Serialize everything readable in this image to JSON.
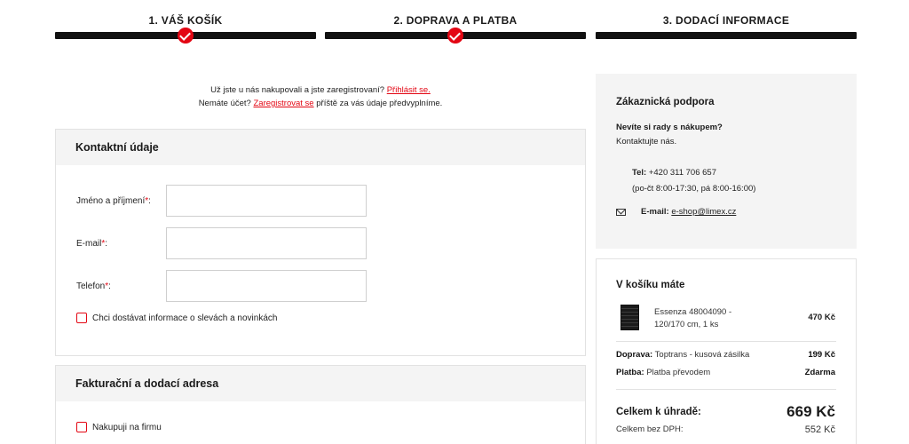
{
  "steps": [
    {
      "label": "1. VÁŠ KOŠÍK",
      "completed": true
    },
    {
      "label": "2. DOPRAVA A PLATBA",
      "completed": true
    },
    {
      "label": "3. DODACÍ INFORMACE",
      "completed": false
    }
  ],
  "login_info": {
    "line1_text": "Už jste u nás nakupovali a jste zaregistrovaní?",
    "login_link": "Přihlásit se.",
    "line2_text_before": "Nemáte účet?",
    "register_link": "Zaregistrovat se",
    "line2_text_after": "příště za vás údaje předvyplníme."
  },
  "contact": {
    "title": "Kontaktní údaje",
    "fields": [
      {
        "label": "Jméno a příjmení",
        "required": "*",
        "value": ""
      },
      {
        "label": "E-mail",
        "required": "*",
        "value": ""
      },
      {
        "label": "Telefon",
        "required": "*",
        "value": ""
      }
    ],
    "newsletter_label": "Chci dostávat informace o slevách a novinkách"
  },
  "billing": {
    "title": "Fakturační a dodací adresa",
    "company_label": "Nakupuji na firmu"
  },
  "support": {
    "title": "Zákaznická podpora",
    "question": "Nevíte si rady s nákupem?",
    "contact_us": "Kontaktujte nás.",
    "tel_label": "Tel:",
    "tel_value": "+420 311 706 657",
    "hours": "(po-čt 8:00-17:30, pá 8:00-16:00)",
    "email_label": "E-mail:",
    "email_value": "e-shop@limex.cz"
  },
  "cart": {
    "title": "V košíku máte",
    "item_name": "Essenza 48004090 - 120/170 cm, 1 ks",
    "item_price": "470 Kč",
    "shipping_label": "Doprava:",
    "shipping_value": "Toptrans - kusová zásilka",
    "shipping_price": "199 Kč",
    "payment_label": "Platba:",
    "payment_value": "Platba převodem",
    "payment_price": "Zdarma",
    "total_label": "Celkem k úhradě:",
    "total_value": "669 Kč",
    "net_label": "Celkem bez DPH:",
    "net_value": "552 Kč"
  },
  "colors": {
    "accent": "#e30613",
    "bar": "#111111",
    "panel_bg": "#f4f4f4"
  }
}
